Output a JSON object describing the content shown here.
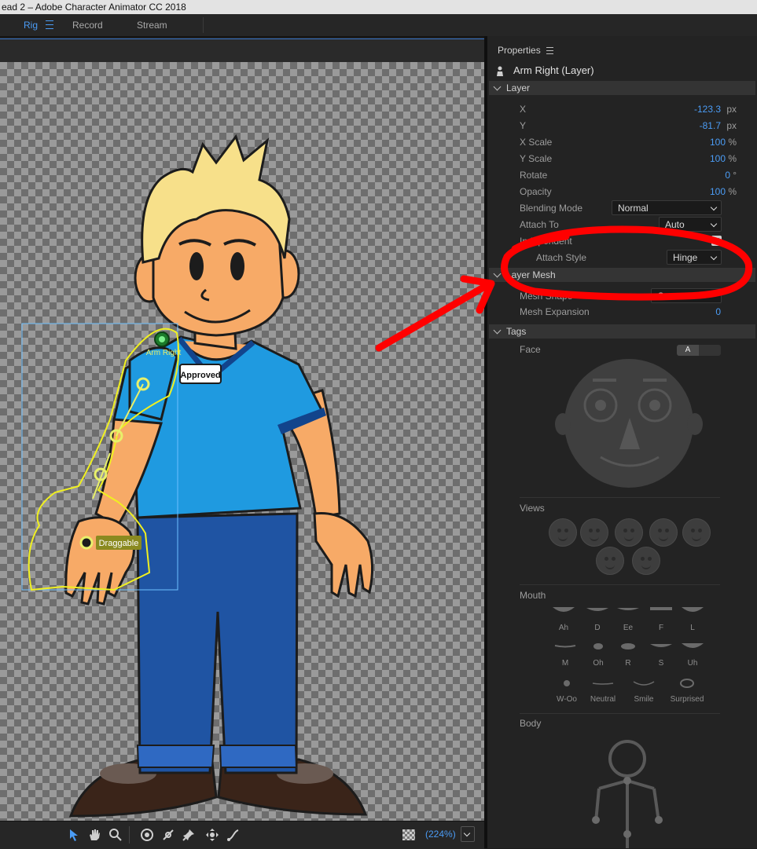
{
  "window": {
    "title": "ead 2 – Adobe Character Animator CC 2018"
  },
  "modes": [
    {
      "label": "Rig",
      "active": true
    },
    {
      "label": "Record",
      "active": false
    },
    {
      "label": "Stream",
      "active": false
    }
  ],
  "scene": {
    "handles": {
      "arm_label": "Arm Right",
      "draggable_label": "Draggable"
    },
    "badge_text": "Approved",
    "zoom": "(224%)",
    "tools": [
      "select-tool-icon",
      "hand-tool-icon",
      "zoom-tool-icon",
      "origin-tool-icon",
      "stick-tool-icon",
      "pin-tool-icon",
      "dangle-tool-icon",
      "draggable-tool-icon"
    ]
  },
  "properties": {
    "panel_title": "Properties",
    "layer_name": "Arm Right (Layer)",
    "layer_section": "Layer",
    "fields": {
      "x": {
        "label": "X",
        "value": "-123.3",
        "unit": "px"
      },
      "y": {
        "label": "Y",
        "value": "-81.7",
        "unit": "px"
      },
      "x_scale": {
        "label": "X Scale",
        "value": "100",
        "unit": "%"
      },
      "y_scale": {
        "label": "Y Scale",
        "value": "100",
        "unit": "%"
      },
      "rotate": {
        "label": "Rotate",
        "value": "0",
        "unit": "°"
      },
      "opacity": {
        "label": "Opacity",
        "value": "100",
        "unit": "%"
      },
      "blending_mode": {
        "label": "Blending Mode",
        "value": "Normal"
      },
      "attach_to": {
        "label": "Attach To",
        "value": "Auto"
      },
      "independent": {
        "label": "Independent",
        "checked": true
      },
      "attach_style": {
        "label": "Attach Style",
        "value": "Hinge"
      }
    },
    "mesh_section": "Layer Mesh",
    "mesh": {
      "shape": {
        "label": "Mesh Shape",
        "value": "Contour"
      },
      "expansion": {
        "label": "Mesh Expansion",
        "value": "0"
      }
    },
    "tags_section": "Tags",
    "tags": {
      "face_label": "Face",
      "face_toggle": "A",
      "views_label": "Views",
      "mouth_label": "Mouth",
      "mouth_shapes": [
        "Ah",
        "D",
        "Ee",
        "F",
        "L",
        "M",
        "Oh",
        "R",
        "S",
        "Uh",
        "W-Oo",
        "Neutral",
        "Smile",
        "Surprised"
      ],
      "body_label": "Body"
    }
  },
  "annotation": {
    "color": "#ff0000"
  }
}
